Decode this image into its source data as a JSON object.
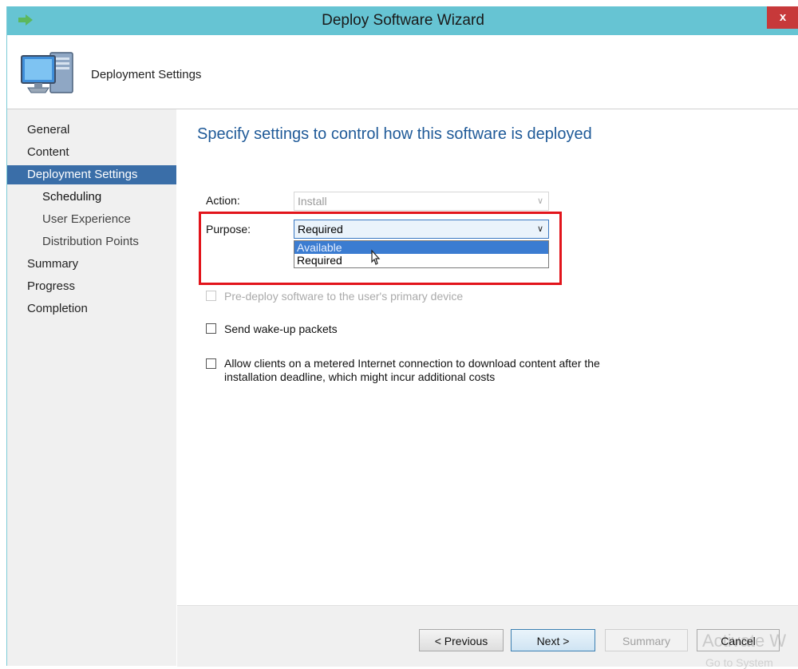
{
  "window": {
    "title": "Deploy Software Wizard",
    "close_label": "x"
  },
  "header": {
    "title": "Deployment Settings"
  },
  "sidebar": {
    "items": [
      {
        "label": "General",
        "level": 0,
        "selected": false
      },
      {
        "label": "Content",
        "level": 0,
        "selected": false
      },
      {
        "label": "Deployment Settings",
        "level": 0,
        "selected": true
      },
      {
        "label": "Scheduling",
        "level": 1,
        "selected": false
      },
      {
        "label": "User Experience",
        "level": 1,
        "selected": false
      },
      {
        "label": "Distribution Points",
        "level": 1,
        "selected": false
      },
      {
        "label": "Summary",
        "level": 0,
        "selected": false
      },
      {
        "label": "Progress",
        "level": 0,
        "selected": false
      },
      {
        "label": "Completion",
        "level": 0,
        "selected": false
      }
    ]
  },
  "main": {
    "heading": "Specify settings to control how this software is deployed",
    "action": {
      "label": "Action:",
      "value": "Install",
      "enabled": false
    },
    "purpose": {
      "label": "Purpose:",
      "value": "Required",
      "dropdown_open": true,
      "options": [
        "Available",
        "Required"
      ],
      "hovered_option": "Available"
    },
    "checkboxes": [
      {
        "label": "Pre-deploy software to the user's primary device",
        "checked": false,
        "enabled": false
      },
      {
        "label": "Send wake-up packets",
        "checked": false,
        "enabled": true
      },
      {
        "label_line1": "Allow clients on a metered Internet connection to download content after the",
        "label_line2": "installation deadline, which might incur additional costs",
        "checked": false,
        "enabled": true
      }
    ]
  },
  "footer": {
    "previous": "< Previous",
    "next": "Next >",
    "summary": "Summary",
    "cancel": "Cancel"
  },
  "watermark": {
    "line1": "Activate W",
    "line2": "Go to System"
  },
  "colors": {
    "titlebar": "#66c4d3",
    "selected_nav": "#3a6ea8",
    "heading": "#1f5a98",
    "highlight_box": "#e2141b",
    "close_button": "#c7393a"
  }
}
